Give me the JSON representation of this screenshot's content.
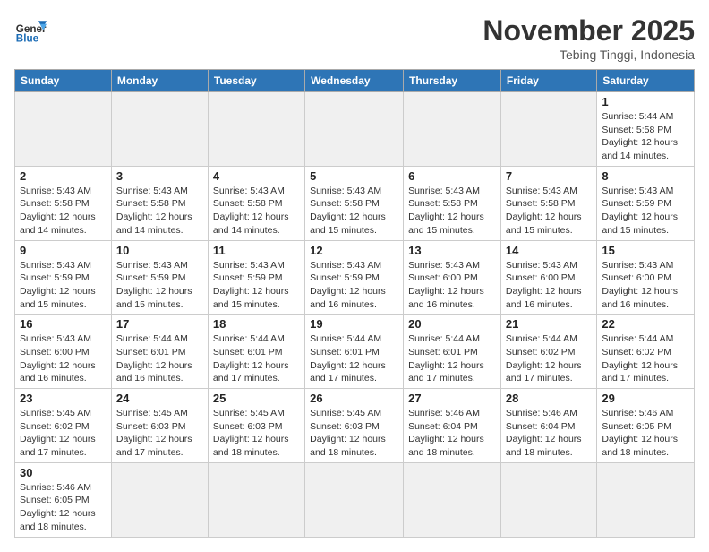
{
  "header": {
    "logo_general": "General",
    "logo_blue": "Blue",
    "month_title": "November 2025",
    "location": "Tebing Tinggi, Indonesia"
  },
  "days_of_week": [
    "Sunday",
    "Monday",
    "Tuesday",
    "Wednesday",
    "Thursday",
    "Friday",
    "Saturday"
  ],
  "weeks": [
    [
      {
        "day": "",
        "info": ""
      },
      {
        "day": "",
        "info": ""
      },
      {
        "day": "",
        "info": ""
      },
      {
        "day": "",
        "info": ""
      },
      {
        "day": "",
        "info": ""
      },
      {
        "day": "",
        "info": ""
      },
      {
        "day": "1",
        "info": "Sunrise: 5:44 AM\nSunset: 5:58 PM\nDaylight: 12 hours and 14 minutes."
      }
    ],
    [
      {
        "day": "2",
        "info": "Sunrise: 5:43 AM\nSunset: 5:58 PM\nDaylight: 12 hours and 14 minutes."
      },
      {
        "day": "3",
        "info": "Sunrise: 5:43 AM\nSunset: 5:58 PM\nDaylight: 12 hours and 14 minutes."
      },
      {
        "day": "4",
        "info": "Sunrise: 5:43 AM\nSunset: 5:58 PM\nDaylight: 12 hours and 14 minutes."
      },
      {
        "day": "5",
        "info": "Sunrise: 5:43 AM\nSunset: 5:58 PM\nDaylight: 12 hours and 15 minutes."
      },
      {
        "day": "6",
        "info": "Sunrise: 5:43 AM\nSunset: 5:58 PM\nDaylight: 12 hours and 15 minutes."
      },
      {
        "day": "7",
        "info": "Sunrise: 5:43 AM\nSunset: 5:58 PM\nDaylight: 12 hours and 15 minutes."
      },
      {
        "day": "8",
        "info": "Sunrise: 5:43 AM\nSunset: 5:59 PM\nDaylight: 12 hours and 15 minutes."
      }
    ],
    [
      {
        "day": "9",
        "info": "Sunrise: 5:43 AM\nSunset: 5:59 PM\nDaylight: 12 hours and 15 minutes."
      },
      {
        "day": "10",
        "info": "Sunrise: 5:43 AM\nSunset: 5:59 PM\nDaylight: 12 hours and 15 minutes."
      },
      {
        "day": "11",
        "info": "Sunrise: 5:43 AM\nSunset: 5:59 PM\nDaylight: 12 hours and 15 minutes."
      },
      {
        "day": "12",
        "info": "Sunrise: 5:43 AM\nSunset: 5:59 PM\nDaylight: 12 hours and 16 minutes."
      },
      {
        "day": "13",
        "info": "Sunrise: 5:43 AM\nSunset: 6:00 PM\nDaylight: 12 hours and 16 minutes."
      },
      {
        "day": "14",
        "info": "Sunrise: 5:43 AM\nSunset: 6:00 PM\nDaylight: 12 hours and 16 minutes."
      },
      {
        "day": "15",
        "info": "Sunrise: 5:43 AM\nSunset: 6:00 PM\nDaylight: 12 hours and 16 minutes."
      }
    ],
    [
      {
        "day": "16",
        "info": "Sunrise: 5:43 AM\nSunset: 6:00 PM\nDaylight: 12 hours and 16 minutes."
      },
      {
        "day": "17",
        "info": "Sunrise: 5:44 AM\nSunset: 6:01 PM\nDaylight: 12 hours and 16 minutes."
      },
      {
        "day": "18",
        "info": "Sunrise: 5:44 AM\nSunset: 6:01 PM\nDaylight: 12 hours and 17 minutes."
      },
      {
        "day": "19",
        "info": "Sunrise: 5:44 AM\nSunset: 6:01 PM\nDaylight: 12 hours and 17 minutes."
      },
      {
        "day": "20",
        "info": "Sunrise: 5:44 AM\nSunset: 6:01 PM\nDaylight: 12 hours and 17 minutes."
      },
      {
        "day": "21",
        "info": "Sunrise: 5:44 AM\nSunset: 6:02 PM\nDaylight: 12 hours and 17 minutes."
      },
      {
        "day": "22",
        "info": "Sunrise: 5:44 AM\nSunset: 6:02 PM\nDaylight: 12 hours and 17 minutes."
      }
    ],
    [
      {
        "day": "23",
        "info": "Sunrise: 5:45 AM\nSunset: 6:02 PM\nDaylight: 12 hours and 17 minutes."
      },
      {
        "day": "24",
        "info": "Sunrise: 5:45 AM\nSunset: 6:03 PM\nDaylight: 12 hours and 17 minutes."
      },
      {
        "day": "25",
        "info": "Sunrise: 5:45 AM\nSunset: 6:03 PM\nDaylight: 12 hours and 18 minutes."
      },
      {
        "day": "26",
        "info": "Sunrise: 5:45 AM\nSunset: 6:03 PM\nDaylight: 12 hours and 18 minutes."
      },
      {
        "day": "27",
        "info": "Sunrise: 5:46 AM\nSunset: 6:04 PM\nDaylight: 12 hours and 18 minutes."
      },
      {
        "day": "28",
        "info": "Sunrise: 5:46 AM\nSunset: 6:04 PM\nDaylight: 12 hours and 18 minutes."
      },
      {
        "day": "29",
        "info": "Sunrise: 5:46 AM\nSunset: 6:05 PM\nDaylight: 12 hours and 18 minutes."
      }
    ],
    [
      {
        "day": "30",
        "info": "Sunrise: 5:46 AM\nSunset: 6:05 PM\nDaylight: 12 hours and 18 minutes."
      },
      {
        "day": "",
        "info": ""
      },
      {
        "day": "",
        "info": ""
      },
      {
        "day": "",
        "info": ""
      },
      {
        "day": "",
        "info": ""
      },
      {
        "day": "",
        "info": ""
      },
      {
        "day": "",
        "info": ""
      }
    ]
  ]
}
